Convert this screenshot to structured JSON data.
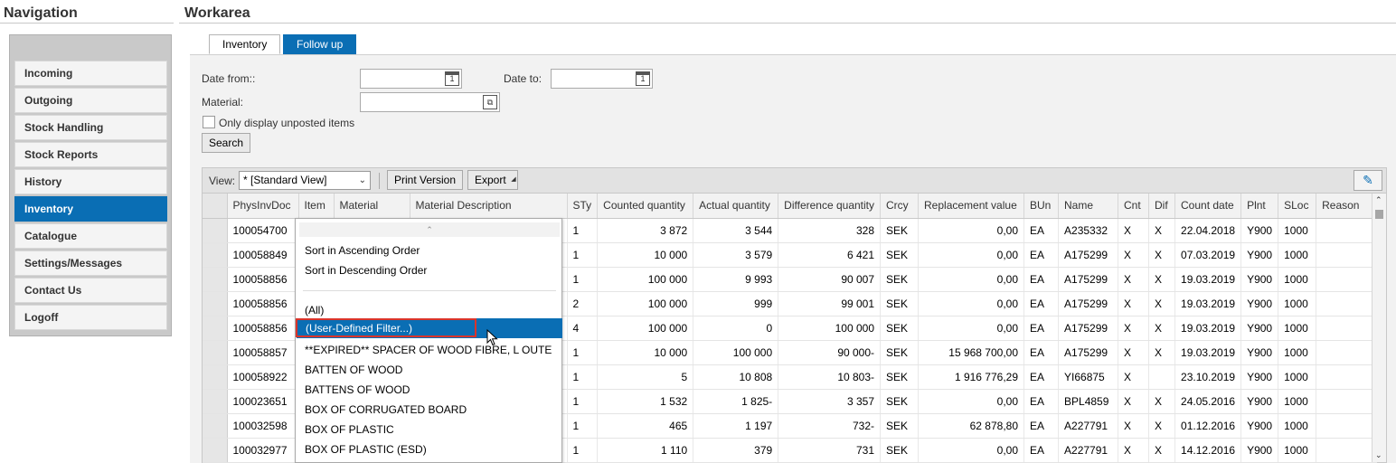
{
  "navigation": {
    "title": "Navigation",
    "items": [
      {
        "label": "Incoming"
      },
      {
        "label": "Outgoing"
      },
      {
        "label": "Stock Handling"
      },
      {
        "label": "Stock Reports"
      },
      {
        "label": "History"
      },
      {
        "label": "Inventory",
        "active": true
      },
      {
        "label": "Catalogue"
      },
      {
        "label": "Settings/Messages"
      },
      {
        "label": "Contact Us"
      },
      {
        "label": "Logoff"
      }
    ]
  },
  "workarea": {
    "title": "Workarea",
    "tabs": [
      {
        "label": "Inventory"
      },
      {
        "label": "Follow up",
        "active": true
      }
    ]
  },
  "form": {
    "date_from_label": "Date from::",
    "date_from_value": "",
    "date_to_label": "Date to:",
    "date_to_value": "",
    "material_label": "Material:",
    "material_value": "",
    "checkbox_label": "Only display unposted items",
    "search_label": "Search"
  },
  "toolbar": {
    "view_label": "View:",
    "view_selected": "* [Standard View]",
    "print_label": "Print Version",
    "export_label": "Export"
  },
  "table": {
    "columns": [
      "PhysInvDoc",
      "Item",
      "Material",
      "Material Description",
      "STy",
      "Counted quantity",
      "Actual quantity",
      "Difference quantity",
      "Crcy",
      "Replacement value",
      "BUn",
      "Name",
      "Cnt",
      "Dif",
      "Count date",
      "Plnt",
      "SLoc",
      "Reason"
    ],
    "rows": [
      [
        "100054700",
        "",
        "",
        "",
        "1",
        "3 872",
        "3 544",
        "328",
        "SEK",
        "0,00",
        "EA",
        "A235332",
        "X",
        "X",
        "22.04.2018",
        "Y900",
        "1000",
        ""
      ],
      [
        "100058849",
        "",
        "",
        "",
        "1",
        "10 000",
        "3 579",
        "6 421",
        "SEK",
        "0,00",
        "EA",
        "A175299",
        "X",
        "X",
        "07.03.2019",
        "Y900",
        "1000",
        ""
      ],
      [
        "100058856",
        "",
        "",
        "",
        "1",
        "100 000",
        "9 993",
        "90 007",
        "SEK",
        "0,00",
        "EA",
        "A175299",
        "X",
        "X",
        "19.03.2019",
        "Y900",
        "1000",
        ""
      ],
      [
        "100058856",
        "",
        "",
        "",
        "2",
        "100 000",
        "999",
        "99 001",
        "SEK",
        "0,00",
        "EA",
        "A175299",
        "X",
        "X",
        "19.03.2019",
        "Y900",
        "1000",
        ""
      ],
      [
        "100058856",
        "",
        "",
        "",
        "4",
        "100 000",
        "0",
        "100 000",
        "SEK",
        "0,00",
        "EA",
        "A175299",
        "X",
        "X",
        "19.03.2019",
        "Y900",
        "1000",
        ""
      ],
      [
        "100058857",
        "",
        "",
        "",
        "1",
        "10 000",
        "100 000",
        "90 000-",
        "SEK",
        "15 968 700,00",
        "EA",
        "A175299",
        "X",
        "X",
        "19.03.2019",
        "Y900",
        "1000",
        ""
      ],
      [
        "100058922",
        "",
        "",
        "",
        "1",
        "5",
        "10 808",
        "10 803-",
        "SEK",
        "1 916 776,29",
        "EA",
        "YI66875",
        "X",
        "",
        "23.10.2019",
        "Y900",
        "1000",
        ""
      ],
      [
        "100023651",
        "",
        "",
        "",
        "1",
        "1 532",
        "1 825-",
        "3 357",
        "SEK",
        "0,00",
        "EA",
        "BPL4859",
        "X",
        "X",
        "24.05.2016",
        "Y900",
        "1000",
        ""
      ],
      [
        "100032598",
        "",
        "",
        "",
        "1",
        "465",
        "1 197",
        "732-",
        "SEK",
        "62 878,80",
        "EA",
        "A227791",
        "X",
        "X",
        "01.12.2016",
        "Y900",
        "1000",
        ""
      ],
      [
        "100032977",
        "",
        "",
        "",
        "1",
        "1 110",
        "379",
        "731",
        "SEK",
        "0,00",
        "EA",
        "A227791",
        "X",
        "X",
        "14.12.2016",
        "Y900",
        "1000",
        ""
      ]
    ]
  },
  "filter_menu": {
    "sort_asc": "Sort in Ascending Order",
    "sort_desc": "Sort in Descending Order",
    "all": "(All)",
    "user_defined": "(User-Defined Filter...)",
    "values": [
      "**EXPIRED** SPACER OF WOOD FIBRE, L OUTE",
      "BATTEN OF WOOD",
      "BATTENS OF WOOD",
      "BOX OF CORRUGATED BOARD",
      "BOX OF PLASTIC",
      "BOX OF PLASTIC (ESD)"
    ]
  },
  "colors": {
    "accent": "#0a6eb4",
    "highlight_border": "#d9342b"
  }
}
